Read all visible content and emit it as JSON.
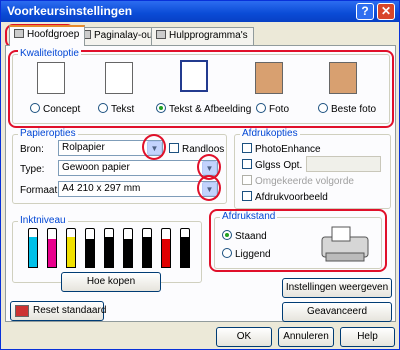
{
  "window": {
    "title": "Voorkeursinstellingen",
    "help_glyph": "?",
    "close_glyph": "✕"
  },
  "tabs": [
    {
      "label": "Hoofdgroep",
      "active": true
    },
    {
      "label": "Paginalay-out",
      "active": false
    },
    {
      "label": "Hulpprogramma's",
      "active": false
    }
  ],
  "quality": {
    "title": "Kwaliteitoptie",
    "options": [
      {
        "label": "Concept",
        "selected": false
      },
      {
        "label": "Tekst",
        "selected": false
      },
      {
        "label": "Tekst & Afbeelding",
        "selected": true
      },
      {
        "label": "Foto",
        "selected": false
      },
      {
        "label": "Beste foto",
        "selected": false
      }
    ]
  },
  "paper": {
    "title": "Papieropties",
    "source_label": "Bron:",
    "source_value": "Rolpapier",
    "borderless_label": "Randloos",
    "type_label": "Type:",
    "type_value": "Gewoon papier",
    "format_label": "Formaat:",
    "format_value": "A4 210 x 297 mm"
  },
  "print_options": {
    "title": "Afdrukopties",
    "photoenhance": "PhotoEnhance",
    "gloss": "Glgss Opt.",
    "reverse": "Omgekeerde volgorde",
    "preview": "Afdrukvoorbeeld"
  },
  "ink": {
    "title": "Inktniveau",
    "button": "Hoe kopen",
    "colors": [
      "#00c0e8",
      "#e8008c",
      "#f0e000",
      "#000000",
      "#000000",
      "#000000",
      "#000000",
      "#e00000",
      "#000000"
    ],
    "levels": [
      0.8,
      0.75,
      0.8,
      0.75,
      0.8,
      0.75,
      0.8,
      0.75,
      0.8
    ]
  },
  "orientation": {
    "title": "Afdrukstand",
    "portrait": "Staand",
    "landscape": "Liggend",
    "selected": "portrait"
  },
  "buttons": {
    "reset": "Reset standaard",
    "show_settings": "Instellingen weergeven",
    "advanced": "Geavanceerd",
    "ok": "OK",
    "cancel": "Annuleren",
    "help": "Help"
  }
}
